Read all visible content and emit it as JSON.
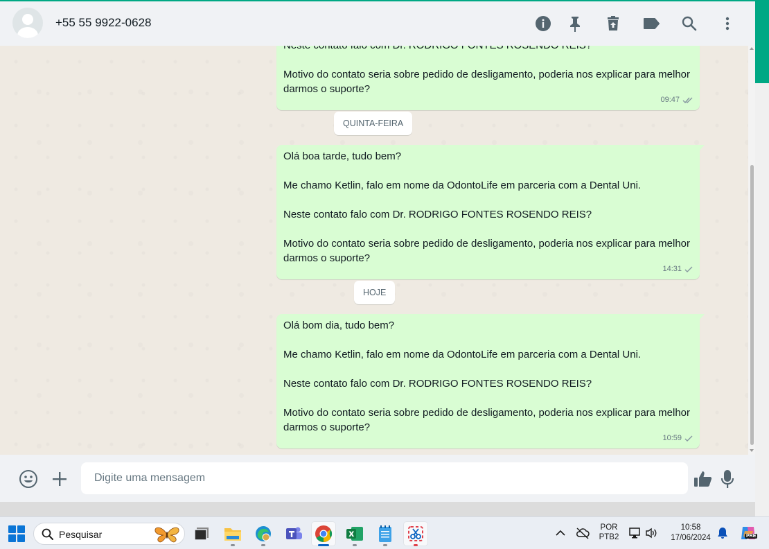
{
  "header": {
    "contact_name": "+55 55 9922-0628",
    "icons": [
      "info-icon",
      "pin-icon",
      "delete-icon",
      "label-icon",
      "search-icon",
      "menu-icon"
    ]
  },
  "chat": {
    "messages": [
      {
        "lines": [
          "Neste contato falo com Dr. RODRIGO FONTES ROSENDO REIS?",
          "Motivo do contato seria sobre pedido de desligamento, poderia nos explicar para melhor darmos o suporte?"
        ],
        "time": "09:47",
        "status": "read"
      },
      {
        "lines": [
          "Olá boa tarde, tudo bem?",
          "Me chamo Ketlin, falo em nome da OdontoLife em parceria com a Dental Uni.",
          "Neste contato falo com Dr. RODRIGO FONTES ROSENDO REIS?",
          "Motivo do contato seria sobre pedido de desligamento, poderia nos explicar para melhor darmos o suporte?"
        ],
        "time": "14:31",
        "status": "sent"
      },
      {
        "lines": [
          "Olá bom dia, tudo bem?",
          "Me chamo Ketlin, falo em nome da OdontoLife em parceria com a Dental Uni.",
          "Neste contato falo com Dr. RODRIGO FONTES ROSENDO REIS?",
          "Motivo do contato seria sobre pedido de desligamento, poderia nos explicar para melhor darmos o suporte?"
        ],
        "time": "10:59",
        "status": "sent"
      }
    ],
    "day_labels": [
      "QUINTA-FEIRA",
      "HOJE"
    ]
  },
  "composer": {
    "placeholder": "Digite uma mensagem"
  },
  "taskbar": {
    "search_label": "Pesquisar",
    "lang_top": "POR",
    "lang_bottom": "PTB2",
    "time": "10:58",
    "date": "17/06/2024",
    "copilot_badge": "PRE"
  },
  "colors": {
    "bubble_out": "#d9fdd3",
    "chat_bg": "#efeae2",
    "header_bg": "#f0f2f5",
    "accent": "#00a884",
    "check_read": "#8696a0"
  }
}
